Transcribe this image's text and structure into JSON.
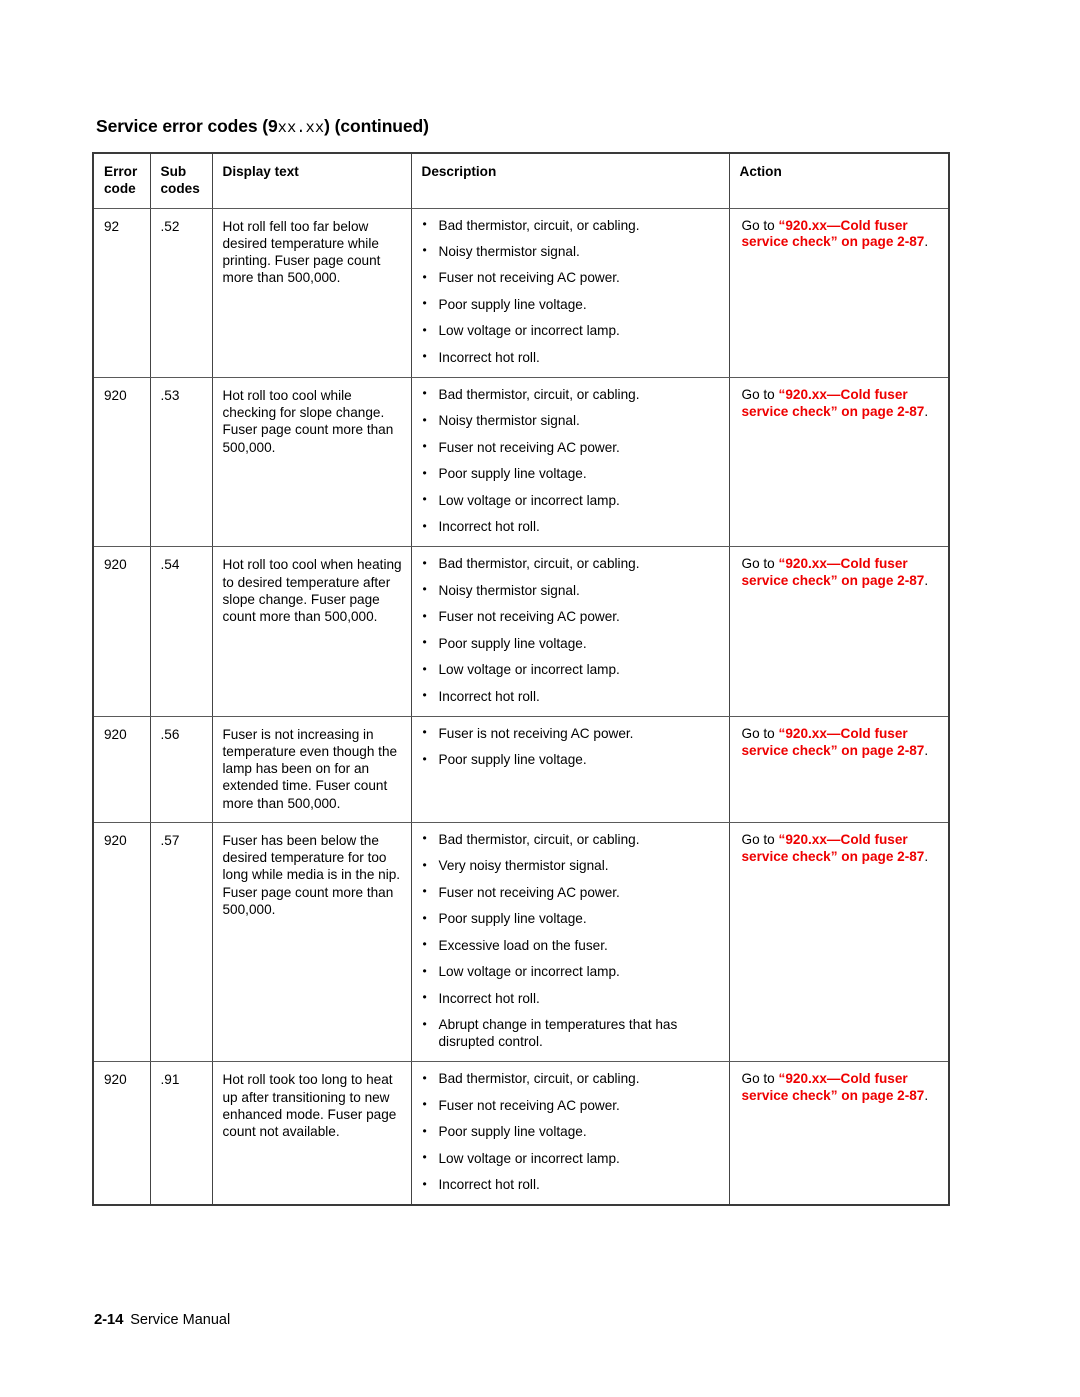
{
  "title": {
    "prefix": "Service error codes (9",
    "code": "xx.xx",
    "suffix": ") (continued)"
  },
  "table": {
    "headers": {
      "error_code": "Error\ncode",
      "error_code_line1": "Error",
      "error_code_line2": "code",
      "sub_codes_line1": "Sub",
      "sub_codes_line2": "codes",
      "display_text": "Display text",
      "description": "Description",
      "action": "Action"
    },
    "rows": [
      {
        "error_code": "92",
        "sub_code": ".52",
        "display_text": "Hot roll fell too far below desired temperature while printing. Fuser page count more than 500,000.",
        "description": [
          "Bad thermistor, circuit, or cabling.",
          "Noisy thermistor signal.",
          "Fuser not receiving AC power.",
          "Poor supply line voltage.",
          "Low voltage or incorrect lamp.",
          "Incorrect hot roll."
        ],
        "action": {
          "lead": "Go to ",
          "link": "“920.xx—Cold fuser service check” on page 2-87",
          "tail": "."
        }
      },
      {
        "error_code": "920",
        "sub_code": ".53",
        "display_text": "Hot roll too cool while checking for slope change. Fuser page count more than 500,000.",
        "description": [
          "Bad thermistor, circuit, or cabling.",
          "Noisy thermistor signal.",
          "Fuser not receiving AC power.",
          "Poor supply line voltage.",
          "Low voltage or incorrect lamp.",
          "Incorrect hot roll."
        ],
        "action": {
          "lead": "Go to ",
          "link": "“920.xx—Cold fuser service check” on page 2-87",
          "tail": "."
        }
      },
      {
        "error_code": "920",
        "sub_code": ".54",
        "display_text": "Hot roll too cool when heating to desired temperature after slope change. Fuser page count more than 500,000.",
        "description": [
          "Bad thermistor, circuit, or cabling.",
          "Noisy thermistor signal.",
          "Fuser not receiving AC power.",
          "Poor supply line voltage.",
          "Low voltage or incorrect lamp.",
          "Incorrect hot roll."
        ],
        "action": {
          "lead": "Go to ",
          "link": "“920.xx—Cold fuser service check” on page 2-87",
          "tail": "."
        }
      },
      {
        "error_code": "920",
        "sub_code": ".56",
        "display_text": "Fuser is not increasing in temperature even though the lamp has been on for an extended time. Fuser count more than 500,000.",
        "description": [
          "Fuser is not receiving AC power.",
          "Poor supply line voltage."
        ],
        "action": {
          "lead": "Go to ",
          "link": "“920.xx—Cold fuser service check” on page 2-87",
          "tail": "."
        }
      },
      {
        "error_code": "920",
        "sub_code": ".57",
        "display_text": "Fuser has been below the desired temperature for too long while media is in the nip. Fuser page count more than 500,000.",
        "description": [
          "Bad thermistor, circuit, or cabling.",
          "Very noisy thermistor signal.",
          "Fuser not receiving AC power.",
          "Poor supply line voltage.",
          "Excessive load on the fuser.",
          "Low voltage or incorrect lamp.",
          "Incorrect hot roll.",
          "Abrupt change in temperatures that has disrupted control."
        ],
        "action": {
          "lead": "Go to ",
          "link": "“920.xx—Cold fuser service check” on page 2-87",
          "tail": "."
        }
      },
      {
        "error_code": "920",
        "sub_code": ".91",
        "display_text": "Hot roll took too long to heat up after transitioning to new enhanced mode. Fuser page count not available.",
        "description": [
          "Bad thermistor, circuit, or cabling.",
          "Fuser not receiving AC power.",
          "Poor supply line voltage.",
          "Low voltage or incorrect lamp.",
          "Incorrect hot roll."
        ],
        "action": {
          "lead": "Go to ",
          "link": "“920.xx—Cold fuser service check” on page 2-87",
          "tail": "."
        }
      }
    ]
  },
  "footer": {
    "folio": "2-14",
    "manual": "Service Manual"
  },
  "colors": {
    "link_red": "#ee0000",
    "text": "#000000",
    "rule": "#444444"
  }
}
